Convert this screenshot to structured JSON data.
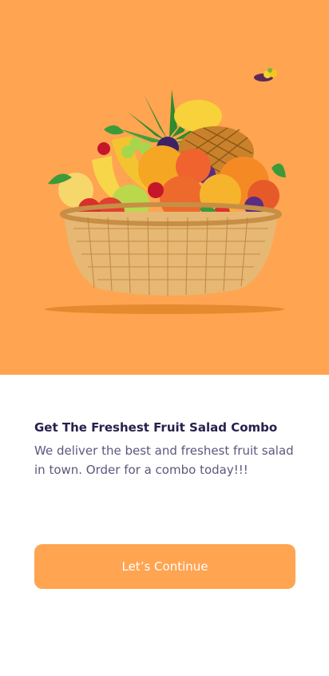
{
  "colors": {
    "accent": "#FFA451",
    "title": "#27214D",
    "body_text": "#5D577E",
    "background": "#FFFFFF"
  },
  "hero": {
    "illustration": "fruit-basket-illustration",
    "small_illustration": "fruit-cluster-icon"
  },
  "onboarding": {
    "title": "Get The Freshest Fruit Salad Combo",
    "description": "We deliver the best and freshest fruit salad in town. Order for a combo today!!!",
    "cta_label": "Let’s Continue"
  }
}
